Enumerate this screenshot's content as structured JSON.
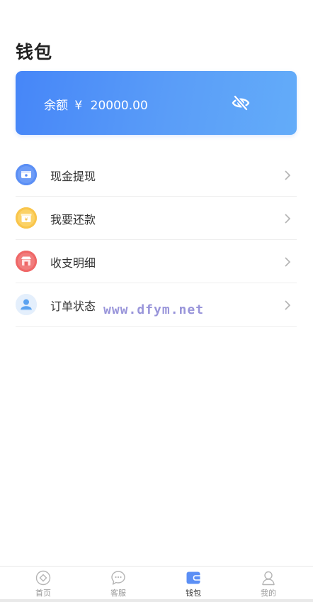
{
  "page": {
    "title": "钱包"
  },
  "balance": {
    "label": "余额",
    "currency": "¥",
    "amount": "20000.00",
    "icon": "eye-off-icon"
  },
  "menu": [
    {
      "label": "现金提现",
      "icon": "cash-withdraw-icon",
      "color": "#5b8ff5"
    },
    {
      "label": "我要还款",
      "icon": "repay-icon",
      "color": "#f9c54b"
    },
    {
      "label": "收支明细",
      "icon": "shop-detail-icon",
      "color": "#ef6767"
    },
    {
      "label": "订单状态",
      "icon": "order-status-icon",
      "color": "#5aa2f0"
    }
  ],
  "watermark": "www.dfym.net",
  "tabbar": {
    "active": "钱包",
    "items": [
      {
        "label": "首页",
        "icon": "home-icon"
      },
      {
        "label": "客服",
        "icon": "chat-icon"
      },
      {
        "label": "钱包",
        "icon": "wallet-icon"
      },
      {
        "label": "我的",
        "icon": "user-icon"
      }
    ]
  }
}
